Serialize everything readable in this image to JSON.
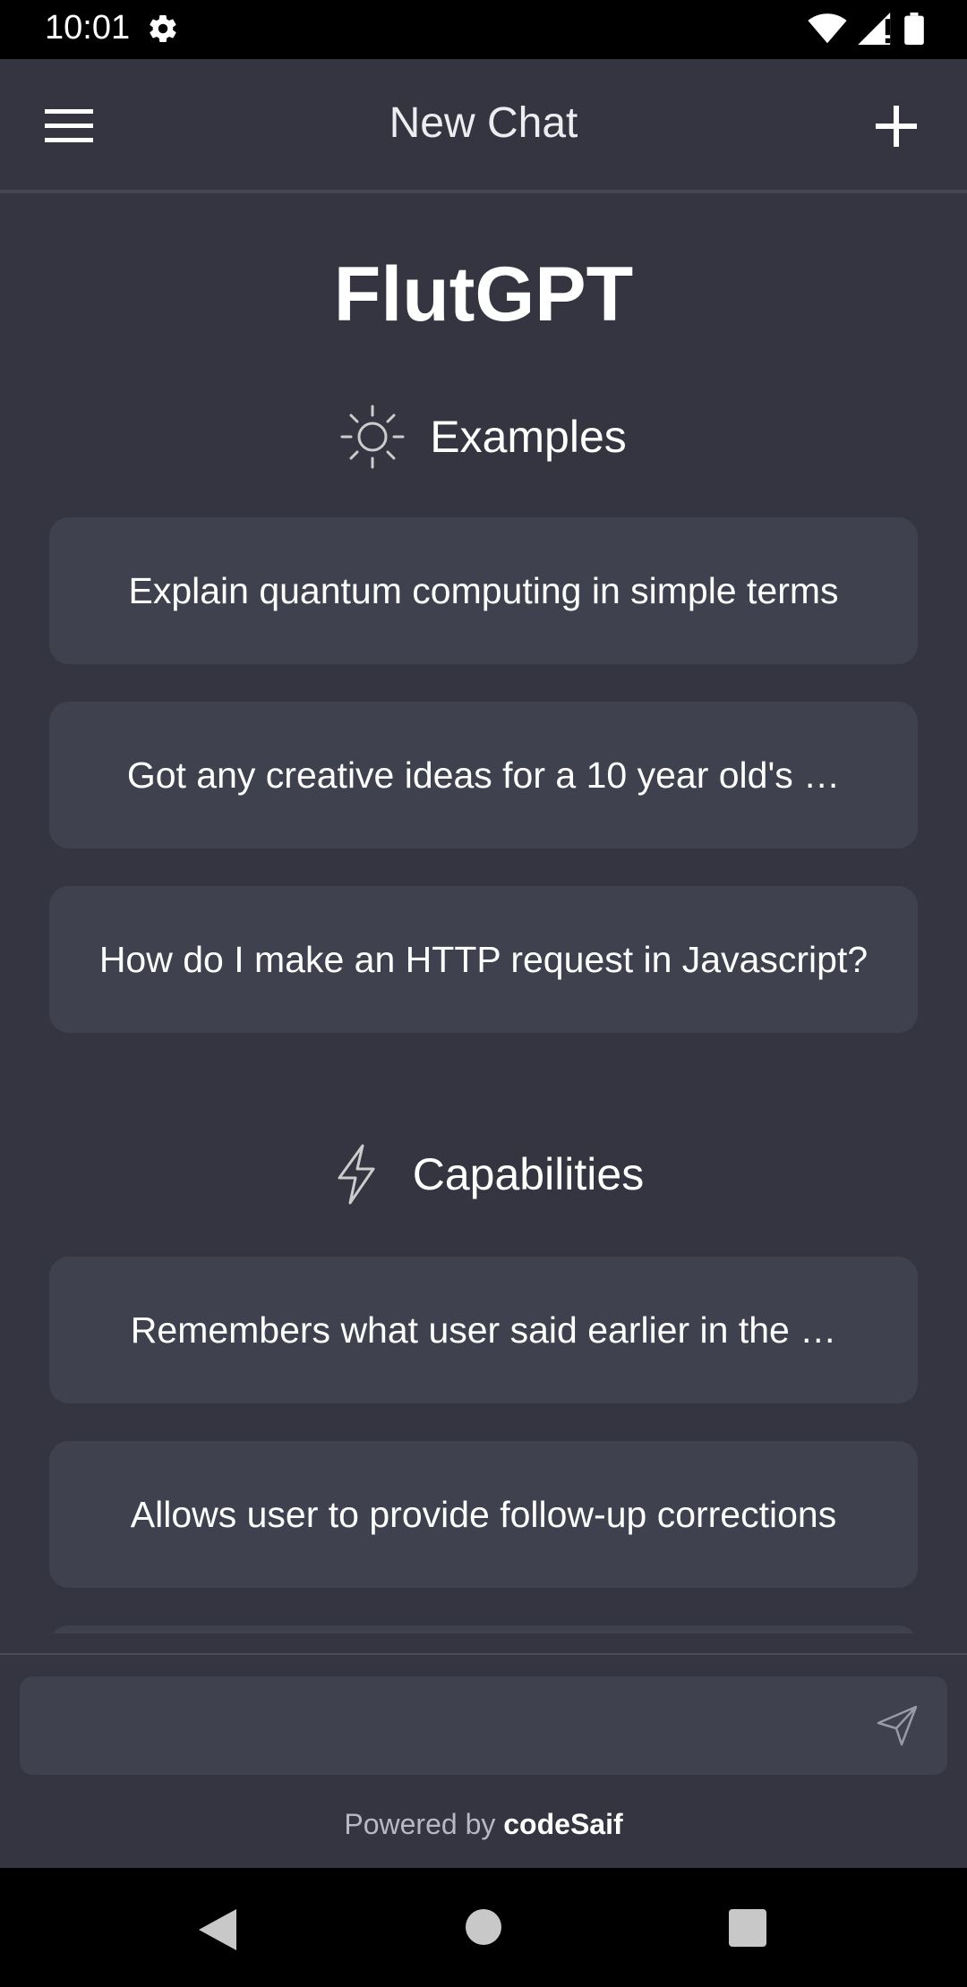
{
  "status_bar": {
    "time": "10:01",
    "icons": [
      "settings-icon",
      "wifi-icon",
      "signal-icon",
      "battery-icon"
    ]
  },
  "app_bar": {
    "title": "New Chat",
    "left_icon": "menu-icon",
    "right_icon": "add-icon"
  },
  "brand": "FlutGPT",
  "examples": {
    "title": "Examples",
    "icon": "sun-icon",
    "items": [
      "Explain quantum computing in simple terms",
      "Got any creative ideas for a 10 year old's …",
      "How do I make an HTTP request in Javascript?"
    ]
  },
  "capabilities": {
    "title": "Capabilities",
    "icon": "lightning-icon",
    "items": [
      "Remembers what user said earlier in the …",
      "Allows user to provide follow-up corrections"
    ]
  },
  "input": {
    "value": "",
    "placeholder": "",
    "send_icon": "send-icon"
  },
  "footer": {
    "prefix": "Powered by",
    "brand": "codeSaif"
  },
  "colors": {
    "background": "#343541",
    "card": "#40414f",
    "text": "#ffffff"
  }
}
